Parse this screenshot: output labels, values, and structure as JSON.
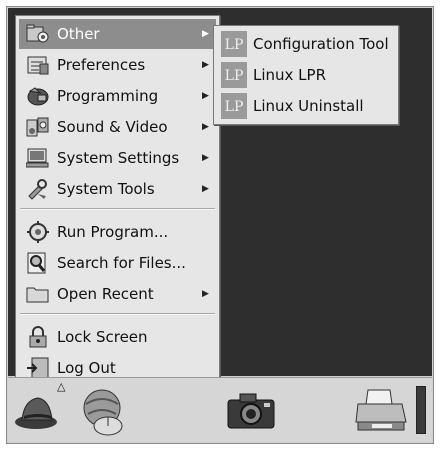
{
  "main_menu": {
    "items": [
      {
        "label": "Other",
        "icon": "other-folder-icon",
        "has_submenu": true,
        "active": true
      },
      {
        "label": "Preferences",
        "icon": "preferences-icon",
        "has_submenu": true
      },
      {
        "label": "Programming",
        "icon": "programming-icon",
        "has_submenu": true
      },
      {
        "label": "Sound & Video",
        "icon": "sound-video-icon",
        "has_submenu": true
      },
      {
        "label": "System Settings",
        "icon": "system-settings-icon",
        "has_submenu": true
      },
      {
        "label": "System Tools",
        "icon": "system-tools-icon",
        "has_submenu": true
      },
      {
        "label": "Run Program...",
        "icon": "run-program-icon",
        "has_submenu": false
      },
      {
        "label": "Search for Files...",
        "icon": "search-icon",
        "has_submenu": false
      },
      {
        "label": "Open Recent",
        "icon": "folder-icon",
        "has_submenu": true
      },
      {
        "label": "Lock Screen",
        "icon": "lock-icon",
        "has_submenu": false
      },
      {
        "label": "Log Out",
        "icon": "logout-icon",
        "has_submenu": false
      }
    ],
    "submenu_arrow": "▶"
  },
  "sub_menu": {
    "items": [
      {
        "label": "Configuration Tool",
        "icon": "lp-icon"
      },
      {
        "label": "Linux LPR",
        "icon": "lp-icon"
      },
      {
        "label": "Linux Uninstall",
        "icon": "lp-icon"
      }
    ],
    "icon_text": "LP"
  },
  "panel": {
    "icons": [
      "redhat-menu-icon",
      "mouse-globe-icon",
      "camera-icon",
      "printer-icon"
    ],
    "menu_indicator": "△"
  }
}
